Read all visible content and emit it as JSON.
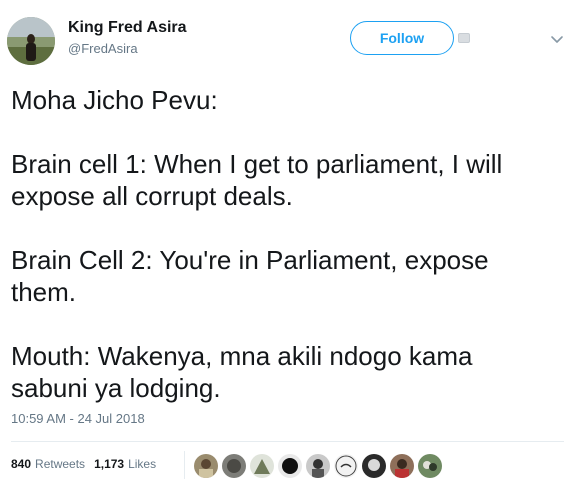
{
  "author": {
    "display_name": "King Fred Asira",
    "handle": "@FredAsira"
  },
  "follow_label": "Follow",
  "tweet": {
    "paragraphs": [
      [
        "Moha Jicho Pevu:"
      ],
      [
        "Brain cell 1: When I get to parliament, I will",
        "expose all corrupt deals."
      ],
      [
        "Brain Cell 2: You're in Parliament,  expose",
        "them."
      ],
      [
        "Mouth: Wakenya, mna akili ndogo kama",
        "sabuni ya lodging."
      ]
    ]
  },
  "timestamp": "10:59 AM - 24 Jul 2018",
  "stats": {
    "retweets_count": "840",
    "retweets_label": "Retweets",
    "likes_count": "1,173",
    "likes_label": "Likes"
  },
  "colors": {
    "accent": "#1da1f2",
    "text": "#14171a",
    "secondary": "#657786"
  },
  "likers_count_shown": 10
}
